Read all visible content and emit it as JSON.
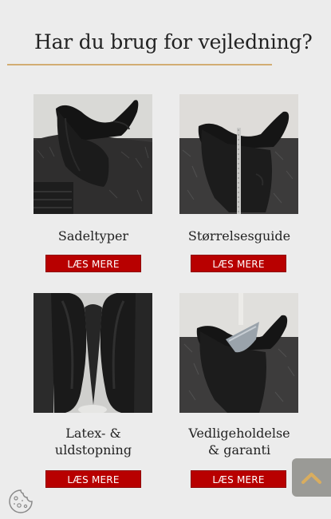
{
  "heading": "Har du brug for vejledning?",
  "colors": {
    "accent_rule": "#d2ad72",
    "button": "#b80000",
    "background": "#ececec"
  },
  "cards": [
    {
      "title": "Sadeltyper",
      "button": "LÆS MERE",
      "image_icon": "saddle-photo"
    },
    {
      "title": "Størrelsesguide",
      "button": "LÆS MERE",
      "image_icon": "saddle-measure-photo"
    },
    {
      "title_line1": "Latex- &",
      "title_line2": "uldstopning",
      "button": "LÆS MERE",
      "image_icon": "saddle-underside-photo"
    },
    {
      "title_line1": "Vedligeholdelse",
      "title_line2": "& garanti",
      "button": "LÆS MERE",
      "image_icon": "saddle-care-photo"
    }
  ],
  "floating": {
    "scroll_top_icon": "chevron-up-icon",
    "cookie_icon": "cookie-icon"
  }
}
